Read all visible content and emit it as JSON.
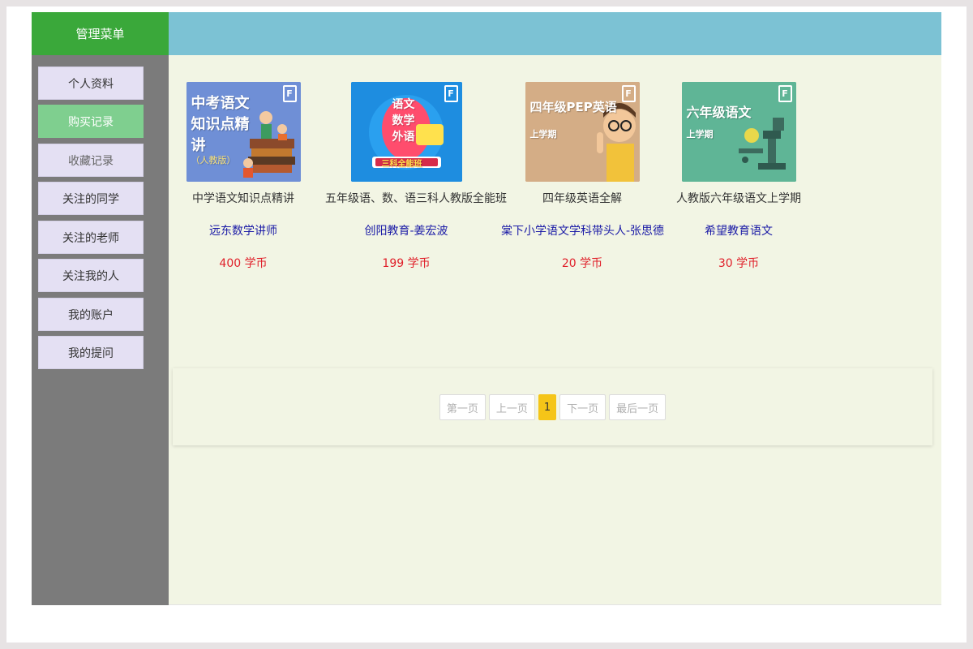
{
  "sidebar": {
    "title": "管理菜单",
    "items": [
      {
        "label": "个人资料"
      },
      {
        "label": "购买记录"
      },
      {
        "label": "收藏记录"
      },
      {
        "label": "关注的同学"
      },
      {
        "label": "关注的老师"
      },
      {
        "label": "关注我的人"
      },
      {
        "label": "我的账户"
      },
      {
        "label": "我的提问"
      }
    ],
    "active_index": 1
  },
  "courses": [
    {
      "cover_title": "中考语文知识点精讲",
      "cover_sub": "（人教版）",
      "cover_color": "#6f8fd6",
      "name": "中学语文知识点精讲",
      "teacher": "远东数学讲师",
      "price": "400 学币"
    },
    {
      "cover_title": "语文 数学 外语",
      "cover_sub": "三科全能班",
      "cover_color": "#1e8de0",
      "name": "五年级语、数、语三科人教版全能班",
      "teacher": "创阳教育-姜宏波",
      "price": "199 学币"
    },
    {
      "cover_title": "四年级PEP英语",
      "cover_sub": "上学期",
      "cover_color": "#d4ad86",
      "name": "四年级英语全解",
      "teacher": "棠下小学语文学科带头人-张思德",
      "price": "20 学币"
    },
    {
      "cover_title": "六年级语文",
      "cover_sub": "上学期",
      "cover_color": "#5fb596",
      "name": "人教版六年级语文上学期",
      "teacher": "希望教育语文",
      "price": "30 学币"
    }
  ],
  "pagination": {
    "first": "第一页",
    "prev": "上一页",
    "current": "1",
    "next": "下一页",
    "last": "最后一页"
  },
  "colors": {
    "menu_head": "#3aa83a",
    "header_bar": "#7cc2d4",
    "sidebar": "#7b7b7b",
    "active_item": "#7fcf8f",
    "content_bg": "#f2f5e4",
    "price": "#e0202a",
    "teacher_link": "#1a1aa6",
    "page_current": "#f5c518"
  },
  "icons": {
    "cover_logo": "brand-logo-icon"
  }
}
